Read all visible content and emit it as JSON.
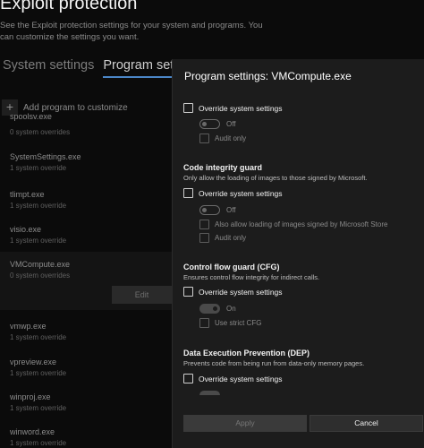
{
  "page": {
    "title": "Exploit protection",
    "description": "See the Exploit protection settings for your system and programs.  You can customize the settings you want."
  },
  "tabs": [
    {
      "label": "System settings",
      "active": false
    },
    {
      "label": "Program settings",
      "active": true
    }
  ],
  "add_program": {
    "label": "Add program to customize",
    "icon": "plus-icon"
  },
  "programs": [
    {
      "name": "spoolsv.exe",
      "sub": "0 system overrides"
    },
    {
      "name": "SystemSettings.exe",
      "sub": "1 system override"
    },
    {
      "name": "tlimpt.exe",
      "sub": "1 system override"
    },
    {
      "name": "visio.exe",
      "sub": "1 system override"
    },
    {
      "name": "VMCompute.exe",
      "sub": "0 system overrides",
      "selected": true
    },
    {
      "name": "vmwp.exe",
      "sub": "1 system override"
    },
    {
      "name": "vpreview.exe",
      "sub": "1 system override"
    },
    {
      "name": "winproj.exe",
      "sub": "1 system override"
    },
    {
      "name": "winword.exe",
      "sub": "1 system override"
    }
  ],
  "edit_button": {
    "label": "Edit"
  },
  "panel": {
    "title": "Program settings: VMCompute.exe",
    "top_section": {
      "override_label": "Override system settings",
      "toggle_label": "Off",
      "audit_label": "Audit only"
    },
    "code_integrity": {
      "title": "Code integrity guard",
      "desc": "Only allow the loading of images to those signed by Microsoft.",
      "override_label": "Override system settings",
      "toggle_label": "Off",
      "store_label": "Also allow loading of images signed by Microsoft Store",
      "audit_label": "Audit only"
    },
    "cfg": {
      "title": "Control flow guard (CFG)",
      "desc": "Ensures control flow integrity for indirect calls.",
      "override_label": "Override system settings",
      "toggle_label": "On",
      "strict_label": "Use strict CFG"
    },
    "dep": {
      "title": "Data Execution Prevention (DEP)",
      "desc": "Prevents code from being run from data-only memory pages.",
      "override_label": "Override system settings"
    },
    "apply_label": "Apply",
    "cancel_label": "Cancel"
  },
  "colors": {
    "accent": "#4b86c7",
    "panel_bg": "#1c1c1c",
    "page_bg": "#0b0b0b"
  }
}
